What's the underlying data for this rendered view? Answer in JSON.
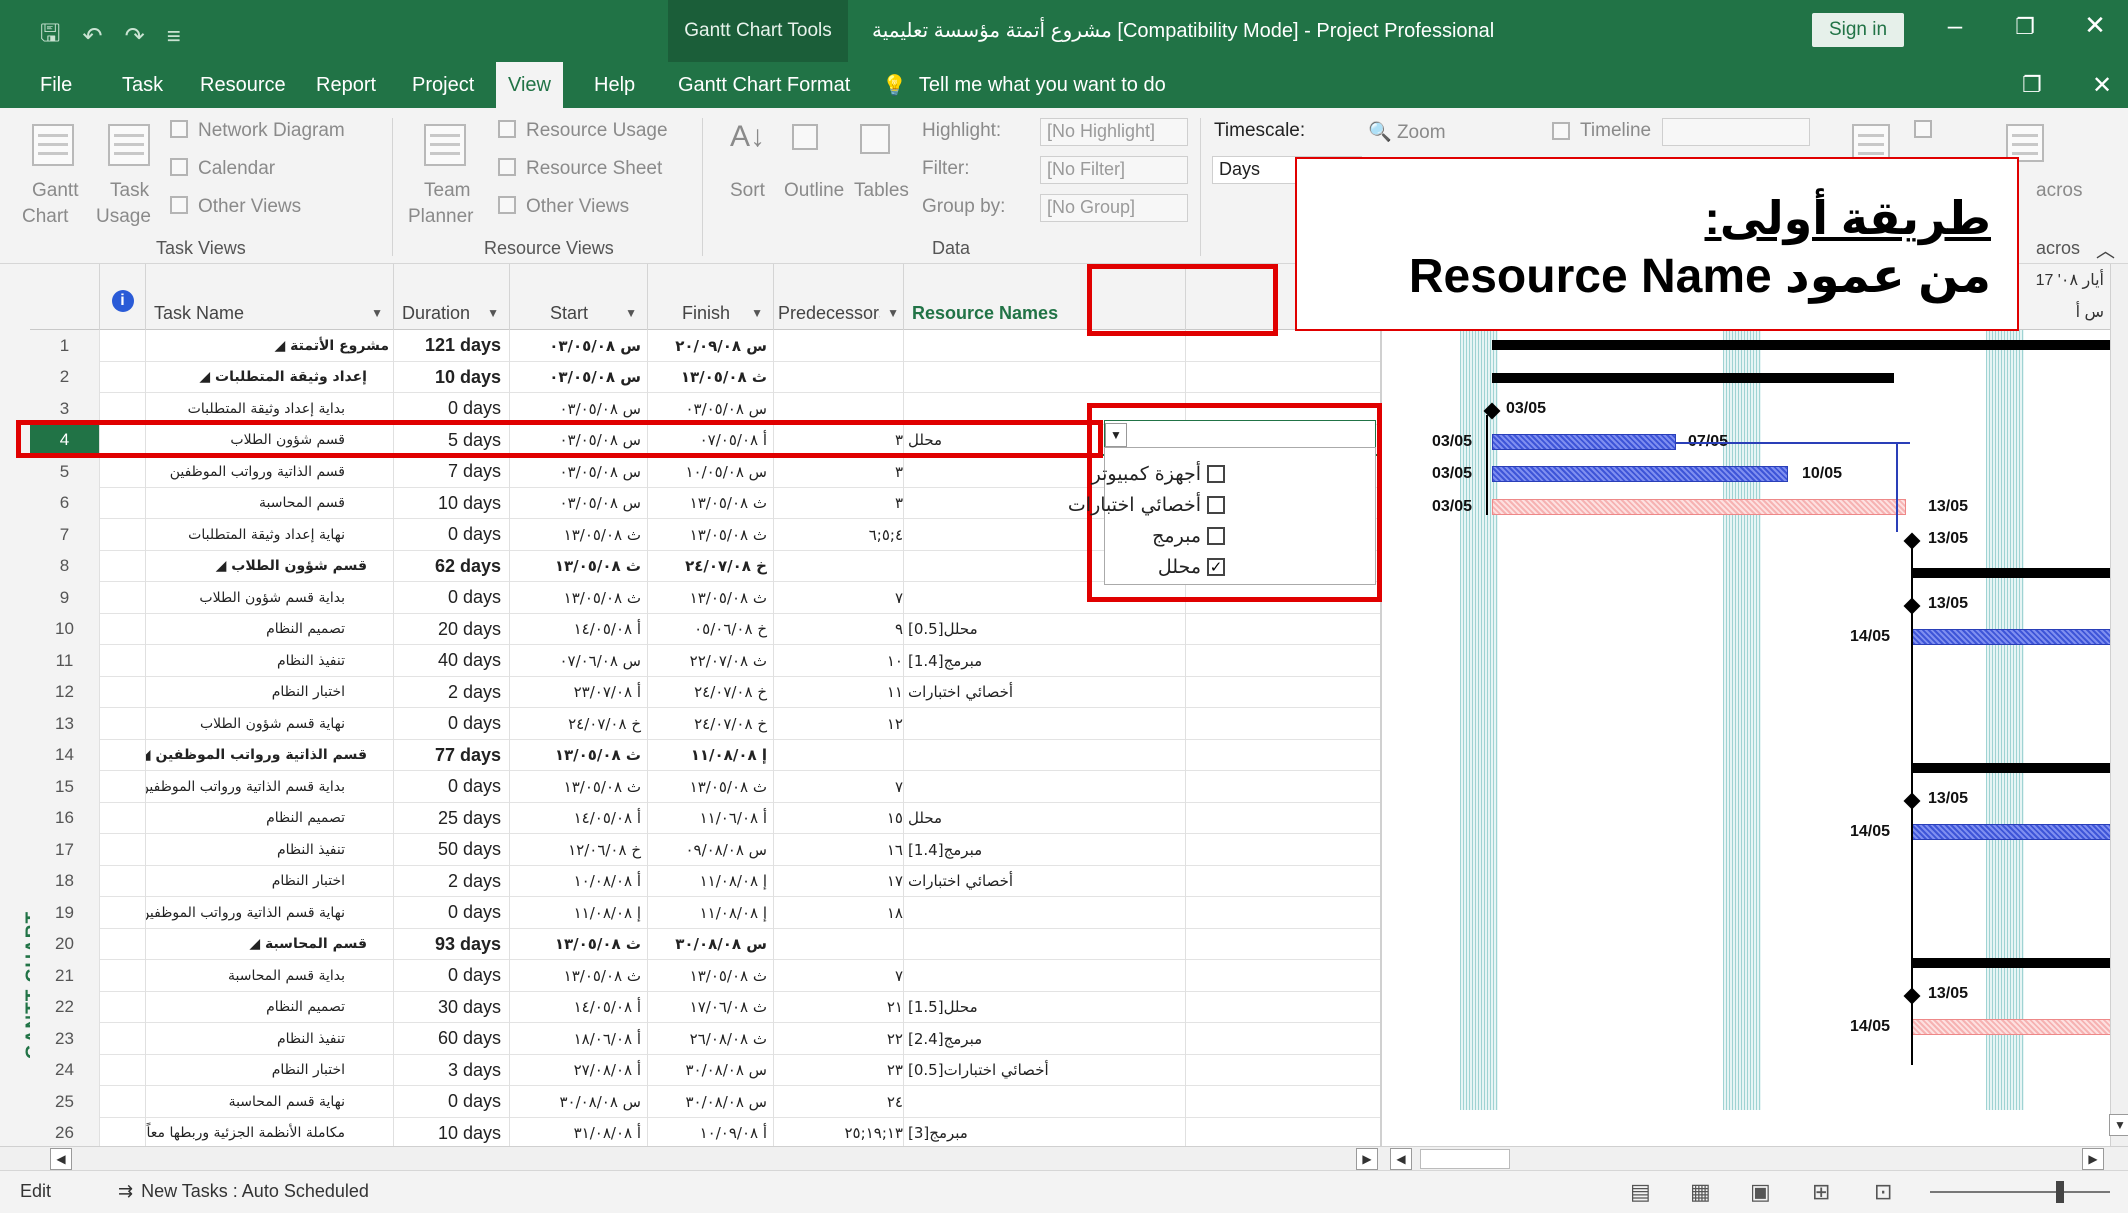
{
  "window": {
    "title": "مشروع أتمتة مؤسسة تعليمية [Compatibility Mode]  -  Project Professional",
    "context_tab": "Gantt Chart Tools",
    "sign_in": "Sign in"
  },
  "menu": {
    "items": [
      "File",
      "Task",
      "Resource",
      "Report",
      "Project",
      "View",
      "Help",
      "Gantt Chart Format"
    ],
    "active": "View",
    "tell_me": "Tell me what you want to do"
  },
  "ribbon": {
    "task_views": {
      "gantt": "Gantt",
      "gantt2": "Chart",
      "task_usage": "Task",
      "task_usage2": "Usage",
      "network": "Network Diagram",
      "calendar": "Calendar",
      "other": "Other Views",
      "group": "Task Views"
    },
    "resource_views": {
      "team": "Team",
      "team2": "Planner",
      "usage": "Resource Usage",
      "sheet": "Resource Sheet",
      "other": "Other Views",
      "group": "Resource Views"
    },
    "data": {
      "sort": "Sort",
      "outline": "Outline",
      "tables": "Tables",
      "highlight": "Highlight:",
      "highlight_val": "[No Highlight]",
      "filter": "Filter:",
      "filter_val": "[No Filter]",
      "group_by": "Group by:",
      "group_val": "[No Group]",
      "group": "Data"
    },
    "zoom": {
      "timescale": "Timescale:",
      "timescale_val": "Days",
      "zoom": "Zoom",
      "timeline": "Timeline",
      "macros": "acros",
      "macros2": "acros"
    }
  },
  "view_label": "GANTT CHART",
  "columns": {
    "name": "Task Name",
    "duration": "Duration",
    "start": "Start",
    "finish": "Finish",
    "predecessors": "Predecessors",
    "resources": "Resource Names"
  },
  "gantt_header": {
    "top": "أيار ٠٨' 17",
    "bottom": "س   أ"
  },
  "tasks": [
    {
      "id": "1",
      "name": "مشروع الأتمتة ◢",
      "duration": "121 days",
      "start": "س ٠٣/٠٥/٠٨",
      "finish": "س ٢٠/٠٩/٠٨",
      "pred": "",
      "res": "",
      "level": 0,
      "summary": true
    },
    {
      "id": "2",
      "name": "إعداد وثيقة المتطلبات ◢",
      "duration": "10 days",
      "start": "س ٠٣/٠٥/٠٨",
      "finish": "ث ١٣/٠٥/٠٨",
      "pred": "",
      "res": "",
      "level": 1,
      "summary": true
    },
    {
      "id": "3",
      "name": "بداية إعداد وثيقة المتطلبات",
      "duration": "0 days",
      "start": "س ٠٣/٠٥/٠٨",
      "finish": "س ٠٣/٠٥/٠٨",
      "pred": "",
      "res": "",
      "level": 2,
      "summary": false
    },
    {
      "id": "4",
      "name": "قسم شؤون الطلاب",
      "duration": "5 days",
      "start": "س ٠٣/٠٥/٠٨",
      "finish": "أ ٠٧/٠٥/٠٨",
      "pred": "٣",
      "res": "محلل",
      "level": 2,
      "summary": false
    },
    {
      "id": "5",
      "name": "قسم الذاتية ورواتب الموظفين",
      "duration": "7 days",
      "start": "س ٠٣/٠٥/٠٨",
      "finish": "س ١٠/٠٥/٠٨",
      "pred": "٣",
      "res": "",
      "level": 2,
      "summary": false
    },
    {
      "id": "6",
      "name": "قسم المحاسبة",
      "duration": "10 days",
      "start": "س ٠٣/٠٥/٠٨",
      "finish": "ث ١٣/٠٥/٠٨",
      "pred": "٣",
      "res": "",
      "level": 2,
      "summary": false
    },
    {
      "id": "7",
      "name": "نهاية إعداد وثيقة المتطلبات",
      "duration": "0 days",
      "start": "ث ١٣/٠٥/٠٨",
      "finish": "ث ١٣/٠٥/٠٨",
      "pred": "٤;٥;٦",
      "res": "",
      "level": 2,
      "summary": false
    },
    {
      "id": "8",
      "name": "قسم شؤون الطلاب ◢",
      "duration": "62 days",
      "start": "ث ١٣/٠٥/٠٨",
      "finish": "خ ٢٤/٠٧/٠٨",
      "pred": "",
      "res": "",
      "level": 1,
      "summary": true
    },
    {
      "id": "9",
      "name": "بداية قسم شؤون الطلاب",
      "duration": "0 days",
      "start": "ث ١٣/٠٥/٠٨",
      "finish": "ث ١٣/٠٥/٠٨",
      "pred": "٧",
      "res": "",
      "level": 2,
      "summary": false
    },
    {
      "id": "10",
      "name": "تصميم النظام",
      "duration": "20 days",
      "start": "أ ١٤/٠٥/٠٨",
      "finish": "خ ٠٥/٠٦/٠٨",
      "pred": "٩",
      "res": "محلل[0.5]",
      "level": 2,
      "summary": false
    },
    {
      "id": "11",
      "name": "تنفيذ النظام",
      "duration": "40 days",
      "start": "س ٠٧/٠٦/٠٨",
      "finish": "ث ٢٢/٠٧/٠٨",
      "pred": "١٠",
      "res": "مبرمج[1.4]",
      "level": 2,
      "summary": false
    },
    {
      "id": "12",
      "name": "اختبار النظام",
      "duration": "2 days",
      "start": "أ ٢٣/٠٧/٠٨",
      "finish": "خ ٢٤/٠٧/٠٨",
      "pred": "١١",
      "res": "أخصائي اختبارات",
      "level": 2,
      "summary": false
    },
    {
      "id": "13",
      "name": "نهاية قسم شؤون الطلاب",
      "duration": "0 days",
      "start": "خ ٢٤/٠٧/٠٨",
      "finish": "خ ٢٤/٠٧/٠٨",
      "pred": "١٢",
      "res": "",
      "level": 2,
      "summary": false
    },
    {
      "id": "14",
      "name": "قسم الذاتية ورواتب الموظفين ◢",
      "duration": "77 days",
      "start": "ث ١٣/٠٥/٠٨",
      "finish": "إ ١١/٠٨/٠٨",
      "pred": "",
      "res": "",
      "level": 1,
      "summary": true
    },
    {
      "id": "15",
      "name": "بداية قسم الذاتية ورواتب الموظفين",
      "duration": "0 days",
      "start": "ث ١٣/٠٥/٠٨",
      "finish": "ث ١٣/٠٥/٠٨",
      "pred": "٧",
      "res": "",
      "level": 2,
      "summary": false
    },
    {
      "id": "16",
      "name": "تصميم النظام",
      "duration": "25 days",
      "start": "أ ١٤/٠٥/٠٨",
      "finish": "أ ١١/٠٦/٠٨",
      "pred": "١٥",
      "res": "محلل",
      "level": 2,
      "summary": false
    },
    {
      "id": "17",
      "name": "تنفيذ النظام",
      "duration": "50 days",
      "start": "خ ١٢/٠٦/٠٨",
      "finish": "س ٠٩/٠٨/٠٨",
      "pred": "١٦",
      "res": "مبرمج[1.4]",
      "level": 2,
      "summary": false
    },
    {
      "id": "18",
      "name": "اختبار النظام",
      "duration": "2 days",
      "start": "أ ١٠/٠٨/٠٨",
      "finish": "إ ١١/٠٨/٠٨",
      "pred": "١٧",
      "res": "أخصائي اختبارات",
      "level": 2,
      "summary": false
    },
    {
      "id": "19",
      "name": "نهاية قسم الذاتية ورواتب الموظفين",
      "duration": "0 days",
      "start": "إ ١١/٠٨/٠٨",
      "finish": "إ ١١/٠٨/٠٨",
      "pred": "١٨",
      "res": "",
      "level": 2,
      "summary": false
    },
    {
      "id": "20",
      "name": "قسم المحاسبة ◢",
      "duration": "93 days",
      "start": "ث ١٣/٠٥/٠٨",
      "finish": "س ٣٠/٠٨/٠٨",
      "pred": "",
      "res": "",
      "level": 1,
      "summary": true
    },
    {
      "id": "21",
      "name": "بداية قسم المحاسبة",
      "duration": "0 days",
      "start": "ث ١٣/٠٥/٠٨",
      "finish": "ث ١٣/٠٥/٠٨",
      "pred": "٧",
      "res": "",
      "level": 2,
      "summary": false
    },
    {
      "id": "22",
      "name": "تصميم النظام",
      "duration": "30 days",
      "start": "أ ١٤/٠٥/٠٨",
      "finish": "ث ١٧/٠٦/٠٨",
      "pred": "٢١",
      "res": "محلل[1.5]",
      "level": 2,
      "summary": false
    },
    {
      "id": "23",
      "name": "تنفيذ النظام",
      "duration": "60 days",
      "start": "أ ١٨/٠٦/٠٨",
      "finish": "ث ٢٦/٠٨/٠٨",
      "pred": "٢٢",
      "res": "مبرمج[2.4]",
      "level": 2,
      "summary": false
    },
    {
      "id": "24",
      "name": "اختبار النظام",
      "duration": "3 days",
      "start": "أ ٢٧/٠٨/٠٨",
      "finish": "س ٣٠/٠٨/٠٨",
      "pred": "٢٣",
      "res": "أخصائي اختبارات[0.5]",
      "level": 2,
      "summary": false
    },
    {
      "id": "25",
      "name": "نهاية قسم المحاسبة",
      "duration": "0 days",
      "start": "س ٣٠/٠٨/٠٨",
      "finish": "س ٣٠/٠٨/٠٨",
      "pred": "٢٤",
      "res": "",
      "level": 2,
      "summary": false
    },
    {
      "id": "26",
      "name": "مكاملة الأنظمة الجزئية وربطها معاً",
      "duration": "10 days",
      "start": "أ ٣١/٠٨/٠٨",
      "finish": "أ ١٠/٠٩/٠٨",
      "pred": "١٣;١٩;٢٥",
      "res": "مبرمج[3]",
      "level": 2,
      "summary": false
    }
  ],
  "resource_dropdown": {
    "options": [
      {
        "label": "أجهزة كمبيوتر",
        "checked": false
      },
      {
        "label": "أخصائي اختبارات",
        "checked": false
      },
      {
        "label": "مبرمج",
        "checked": false
      },
      {
        "label": "محلل",
        "checked": true
      }
    ]
  },
  "gantt_labels": {
    "d1": "03/05",
    "r4s": "03/05",
    "r4e": "07/05",
    "r5s": "03/05",
    "r5e": "10/05",
    "r6s": "03/05",
    "r6e": "13/05",
    "r7": "13/05",
    "r9": "13/05",
    "r10": "14/05",
    "r15": "13/05",
    "r16": "14/05",
    "r21": "13/05",
    "r22": "14/05"
  },
  "callout": {
    "line1": "طريقة أولى:",
    "line2": "من عمود Resource Name"
  },
  "status": {
    "mode": "Edit",
    "scheduling": "New Tasks : Auto Scheduled"
  },
  "colors": {
    "brand": "#217346",
    "highlight": "#e00000"
  }
}
